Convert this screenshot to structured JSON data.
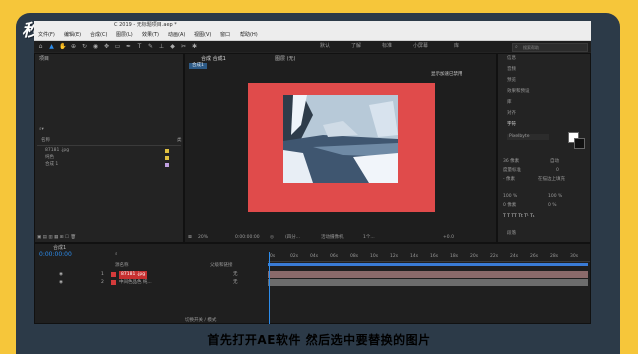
{
  "watermark": "秒懂视频",
  "window_title": "C 2019 - 无标题项目.aep *",
  "menu": [
    "文件(F)",
    "编辑(E)",
    "合成(C)",
    "图层(L)",
    "效果(T)",
    "动画(A)",
    "视图(V)",
    "窗口",
    "帮助(H)"
  ],
  "workspaces": [
    "默认",
    "了解",
    "标准",
    "小屏幕",
    "库"
  ],
  "search_placeholder": "搜索帮助",
  "project": {
    "tab": "项目",
    "col_name": "名称",
    "col_type": "类",
    "items": [
      "87181 .jpg",
      "纯色",
      "合成 1"
    ]
  },
  "composition": {
    "tab": "合成 合成1",
    "layer_tab": "图层 (无)",
    "sub_tab": "合成1",
    "notice": "显示加速已禁用",
    "zoom": "20%",
    "timecode": "0:00:00:00",
    "resolution": "(四分...",
    "camera": "活动摄像机",
    "views": "1个...",
    "exposure": "+0.0"
  },
  "right_panel": {
    "sections": [
      "信息",
      "音频",
      "预览",
      "效果和预设",
      "库",
      "对齐",
      "字符"
    ],
    "font": "Pixelbyte",
    "font_size": "36 像素",
    "leading": "自动",
    "kerning": "度量标准",
    "tracking": "0",
    "stroke": "- 像素",
    "stroke_mode": "在描边上填充",
    "vscale": "100 %",
    "hscale": "100 %",
    "baseline": "0 像素",
    "tsume": "0 %",
    "paragraph": "段落"
  },
  "timeline": {
    "tab": "合成1",
    "timecode": "0:00:00:00",
    "col_source": "源名称",
    "col_parent": "父级和链接",
    "layers": [
      {
        "num": "1",
        "name": "87181 .jpg",
        "parent": "无"
      },
      {
        "num": "2",
        "name": "中间色品色 纯...",
        "parent": "无"
      }
    ],
    "ruler": [
      "0s",
      "02s",
      "04s",
      "06s",
      "08s",
      "10s",
      "12s",
      "14s",
      "16s",
      "18s",
      "20s",
      "22s",
      "24s",
      "26s",
      "28s",
      "30s"
    ],
    "footer": "切换开关 / 模式"
  },
  "caption": "首先打开AE软件 然后选中要替换的图片",
  "colors": {
    "background": "#f6c63a",
    "frame": "#2c3a48",
    "comp_bg": "#e04b4b",
    "accent": "#2d8ceb",
    "layer_label": "#d33b3b"
  }
}
